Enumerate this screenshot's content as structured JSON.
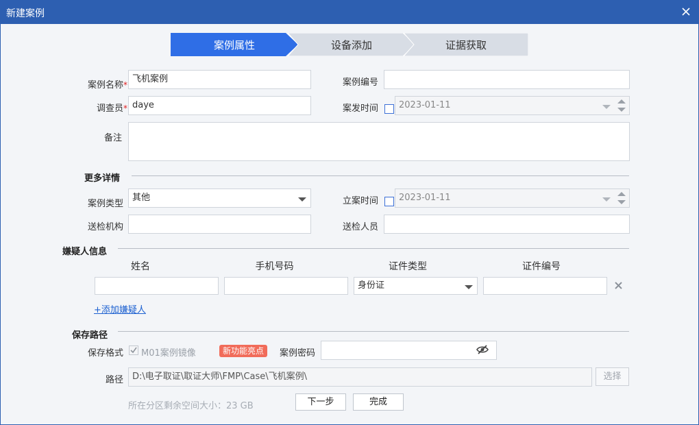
{
  "window": {
    "title": "新建案例",
    "close_icon": "close-icon"
  },
  "steps": [
    {
      "label": "案例属性",
      "active": true
    },
    {
      "label": "设备添加",
      "active": false
    },
    {
      "label": "证据获取",
      "active": false
    }
  ],
  "colors": {
    "title_bar": "#2d5fb1",
    "step_active": "#2f6ee6",
    "step_inactive": "#d8dde5",
    "link": "#1a5fd0",
    "badge": "#f16c5a",
    "checkbox_border": "#3b6fd6"
  },
  "required_mark": "*",
  "form": {
    "case_name_label": "案例名称",
    "case_name_value": "飞机案例",
    "case_number_label": "案例编号",
    "case_number_value": "",
    "investigator_label": "调查员",
    "investigator_value": "daye",
    "incident_time_label": "案发时间",
    "incident_time_value": "2023-01-11",
    "remark_label": "备注",
    "remark_value": ""
  },
  "more_details": {
    "section_title": "更多详情",
    "case_type_label": "案例类型",
    "case_type_value": "其他",
    "filing_time_label": "立案时间",
    "filing_time_value": "2023-01-11",
    "submit_org_label": "送检机构",
    "submit_org_value": "",
    "submitter_label": "送检人员",
    "submitter_value": ""
  },
  "suspect": {
    "section_title": "嫌疑人信息",
    "columns": [
      "姓名",
      "手机号码",
      "证件类型",
      "证件编号"
    ],
    "row": {
      "name": "",
      "phone": "",
      "id_type": "身份证",
      "id_number": ""
    },
    "add_link": "+添加嫌疑人"
  },
  "save_path": {
    "section_title": "保存路径",
    "format_label": "保存格式",
    "format_option": "M01案例镜像",
    "format_checked": true,
    "new_badge": "新功能亮点",
    "password_label": "案例密码",
    "password_value": "",
    "path_label": "路径",
    "path_value": "D:\\电子取证\\取证大师\\FMP\\Case\\飞机案例\\",
    "browse_button": "选择",
    "free_space": "所在分区剩余空间大小：23 GB"
  },
  "actions": {
    "next": "下一步",
    "finish": "完成"
  }
}
